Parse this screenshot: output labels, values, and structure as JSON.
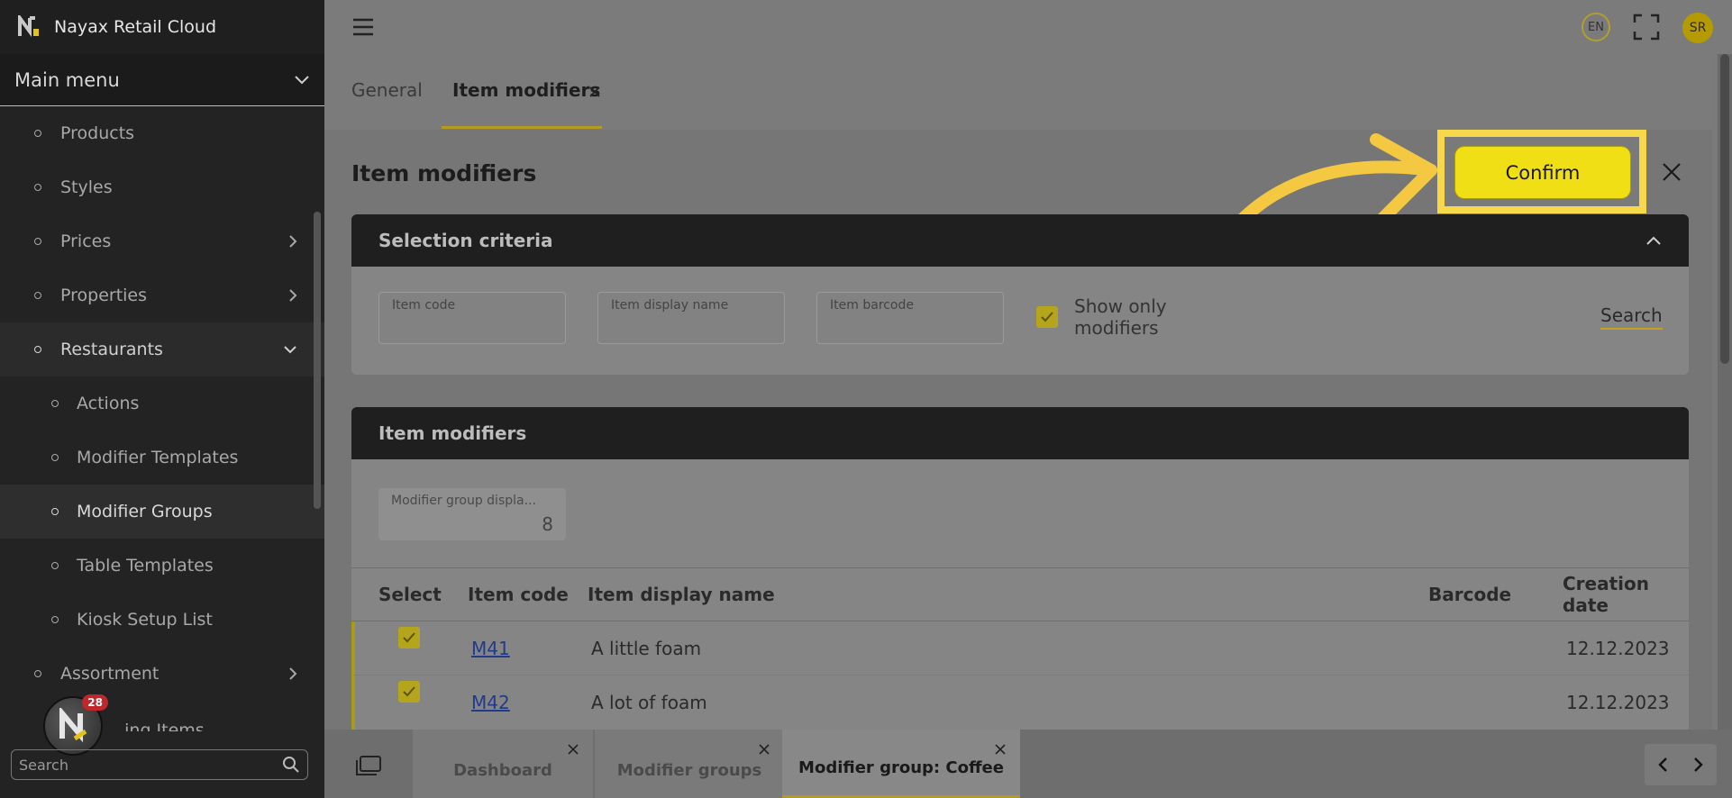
{
  "app": {
    "title": "Nayax Retail Cloud"
  },
  "sidebar": {
    "main_menu_label": "Main menu",
    "items": [
      {
        "label": "Products"
      },
      {
        "label": "Styles"
      },
      {
        "label": "Prices"
      },
      {
        "label": "Properties"
      },
      {
        "label": "Restaurants"
      },
      {
        "label": "Actions"
      },
      {
        "label": "Modifier Templates"
      },
      {
        "label": "Modifier Groups"
      },
      {
        "label": "Table Templates"
      },
      {
        "label": "Kiosk Setup List"
      },
      {
        "label": "Assortment"
      },
      {
        "label": "...ing Items"
      }
    ],
    "search_placeholder": "Search",
    "notification_count": "28"
  },
  "header": {
    "language": "EN",
    "user_initials": "SR"
  },
  "tabs": [
    {
      "label": "General"
    },
    {
      "label": "Item modifiers"
    }
  ],
  "page": {
    "title": "Item modifiers",
    "confirm_label": "Confirm"
  },
  "selection_criteria": {
    "title": "Selection criteria",
    "fields": [
      {
        "label": "Item code",
        "value": ""
      },
      {
        "label": "Item display name",
        "value": ""
      },
      {
        "label": "Item barcode",
        "value": ""
      }
    ],
    "show_only_modifiers": {
      "label": "Show only modifiers",
      "checked": true
    },
    "search_label": "Search"
  },
  "modifiers": {
    "title": "Item modifiers",
    "group_field": {
      "label": "Modifier group displa...",
      "value": "8"
    },
    "columns": [
      "Select",
      "Item code",
      "Item display name",
      "Barcode",
      "Creation date"
    ],
    "rows": [
      {
        "selected": true,
        "code": "M41",
        "name": "A little foam",
        "barcode": "",
        "date": "12.12.2023"
      },
      {
        "selected": true,
        "code": "M42",
        "name": "A lot of foam",
        "barcode": "",
        "date": "12.12.2023"
      }
    ]
  },
  "bottom_tabs": [
    {
      "label": "Dashboard"
    },
    {
      "label": "Modifier groups"
    },
    {
      "label": "Modifier group: Coffee"
    }
  ],
  "colors": {
    "accent": "#f0df15",
    "highlight": "#f7d84a",
    "arrow": "#f5c842"
  }
}
